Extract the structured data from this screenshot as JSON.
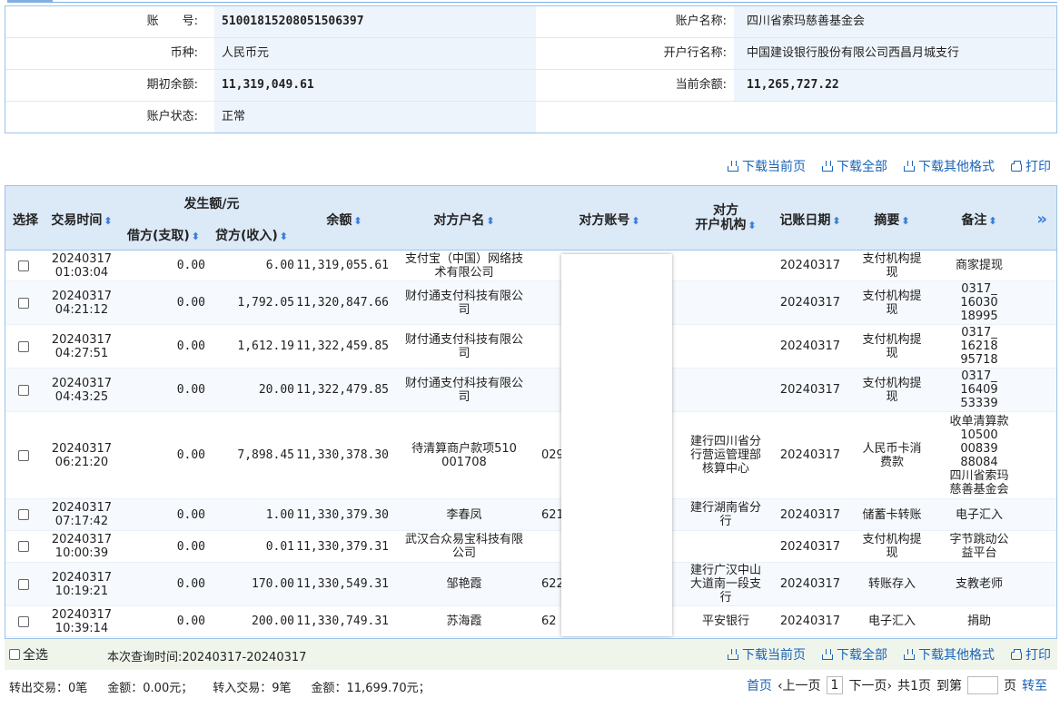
{
  "account": {
    "number_label": "账　　号:",
    "number": "51001815208051506397",
    "name_label": "账户名称:",
    "name": "四川省索玛慈善基金会",
    "currency_label": "币种:",
    "currency": "人民币元",
    "bank_label": "开户行名称:",
    "bank": "中国建设银行股份有限公司西昌月城支行",
    "opening_label": "期初余额:",
    "opening": "11,319,049.61",
    "current_label": "当前余额:",
    "current": "11,265,727.22",
    "status_label": "账户状态:",
    "status": "正常"
  },
  "actions": {
    "download_page": "下载当前页",
    "download_all": "下载全部",
    "download_other": "下载其他格式",
    "print": "打印"
  },
  "table": {
    "headers": {
      "select": "选择",
      "time": "交易时间",
      "amount_group": "发生额/元",
      "debit": "借方(支取)",
      "credit": "贷方(收入)",
      "balance": "余额",
      "party_name": "对方户名",
      "party_account": "对方账号",
      "party_bank_1": "对方",
      "party_bank_2": "开户机构",
      "post_date": "记账日期",
      "summary": "摘要",
      "remark": "备注",
      "more": "»"
    },
    "rows": [
      {
        "date": "20240317",
        "time": "01:03:04",
        "debit": "0.00",
        "credit": "6.00",
        "balance": "11,319,055.61",
        "party": [
          "支付宝（中国）网络技",
          "术有限公司"
        ],
        "acct": "",
        "bank": [],
        "post": "20240317",
        "summary": [
          "支付机构提",
          "现"
        ],
        "remark": [
          "商家提现"
        ]
      },
      {
        "date": "20240317",
        "time": "04:21:12",
        "debit": "0.00",
        "credit": "1,792.05",
        "balance": "11,320,847.66",
        "party": [
          "财付通支付科技有限公",
          "司"
        ],
        "acct": "",
        "bank": [],
        "post": "20240317",
        "summary": [
          "支付机构提",
          "现"
        ],
        "remark": [
          "0317_",
          "16030",
          "18995"
        ]
      },
      {
        "date": "20240317",
        "time": "04:27:51",
        "debit": "0.00",
        "credit": "1,612.19",
        "balance": "11,322,459.85",
        "party": [
          "财付通支付科技有限公",
          "司"
        ],
        "acct": "",
        "bank": [],
        "post": "20240317",
        "summary": [
          "支付机构提",
          "现"
        ],
        "remark": [
          "0317_",
          "16218",
          "95718"
        ]
      },
      {
        "date": "20240317",
        "time": "04:43:25",
        "debit": "0.00",
        "credit": "20.00",
        "balance": "11,322,479.85",
        "party": [
          "财付通支付科技有限公",
          "司"
        ],
        "acct": "",
        "bank": [],
        "post": "20240317",
        "summary": [
          "支付机构提",
          "现"
        ],
        "remark": [
          "0317_",
          "16409",
          "53339"
        ]
      },
      {
        "date": "20240317",
        "time": "06:21:20",
        "debit": "0.00",
        "credit": "7,898.45",
        "balance": "11,330,378.30",
        "party": [
          "待清算商户款项510",
          "001708"
        ],
        "acct": "029",
        "bank": [
          "建行四川省分",
          "行营运管理部",
          "核算中心"
        ],
        "post": "20240317",
        "summary": [
          "人民币卡消",
          "费款"
        ],
        "remark": [
          "收单清算款",
          "10500",
          "00839",
          "88084",
          "四川省索玛",
          "慈善基金会"
        ]
      },
      {
        "date": "20240317",
        "time": "07:17:42",
        "debit": "0.00",
        "credit": "1.00",
        "balance": "11,330,379.30",
        "party": [
          "李春凤"
        ],
        "acct": "621",
        "bank": [
          "建行湖南省分",
          "行"
        ],
        "post": "20240317",
        "summary": [
          "储蓄卡转账"
        ],
        "remark": [
          "电子汇入"
        ]
      },
      {
        "date": "20240317",
        "time": "10:00:39",
        "debit": "0.00",
        "credit": "0.01",
        "balance": "11,330,379.31",
        "party": [
          "武汉合众易宝科技有限",
          "公司"
        ],
        "acct": "",
        "bank": [],
        "post": "20240317",
        "summary": [
          "支付机构提",
          "现"
        ],
        "remark": [
          "字节跳动公",
          "益平台"
        ]
      },
      {
        "date": "20240317",
        "time": "10:19:21",
        "debit": "0.00",
        "credit": "170.00",
        "balance": "11,330,549.31",
        "party": [
          "邹艳霞"
        ],
        "acct": "622",
        "bank": [
          "建行广汉中山",
          "大道南一段支",
          "行"
        ],
        "post": "20240317",
        "summary": [
          "转账存入"
        ],
        "remark": [
          "支教老师"
        ]
      },
      {
        "date": "20240317",
        "time": "10:39:14",
        "debit": "0.00",
        "credit": "200.00",
        "balance": "11,330,749.31",
        "party": [
          "苏海霞"
        ],
        "acct": "62",
        "bank": [
          "平安银行"
        ],
        "post": "20240317",
        "summary": [
          "电子汇入"
        ],
        "remark": [
          "捐助"
        ]
      }
    ]
  },
  "footer": {
    "select_all": "全选",
    "query_time": "本次查询时间:20240317-20240317",
    "out_count": "转出交易：0笔",
    "out_amount": "金额：0.00元；",
    "in_count": "转入交易：9笔",
    "in_amount": "金额：11,699.70元；",
    "first": "首页",
    "prev": "‹上一页",
    "page": "1",
    "next": "下一页›",
    "total": "共1页",
    "goto": "到第",
    "page_unit": "页",
    "go": "转至"
  },
  "colors": {
    "accent": "#1a64b8",
    "header_bg": "#dce9f7",
    "border": "#9cc3e8"
  },
  "icons": [
    "download-icon",
    "print-icon",
    "sort-icon",
    "expand-columns-icon"
  ]
}
